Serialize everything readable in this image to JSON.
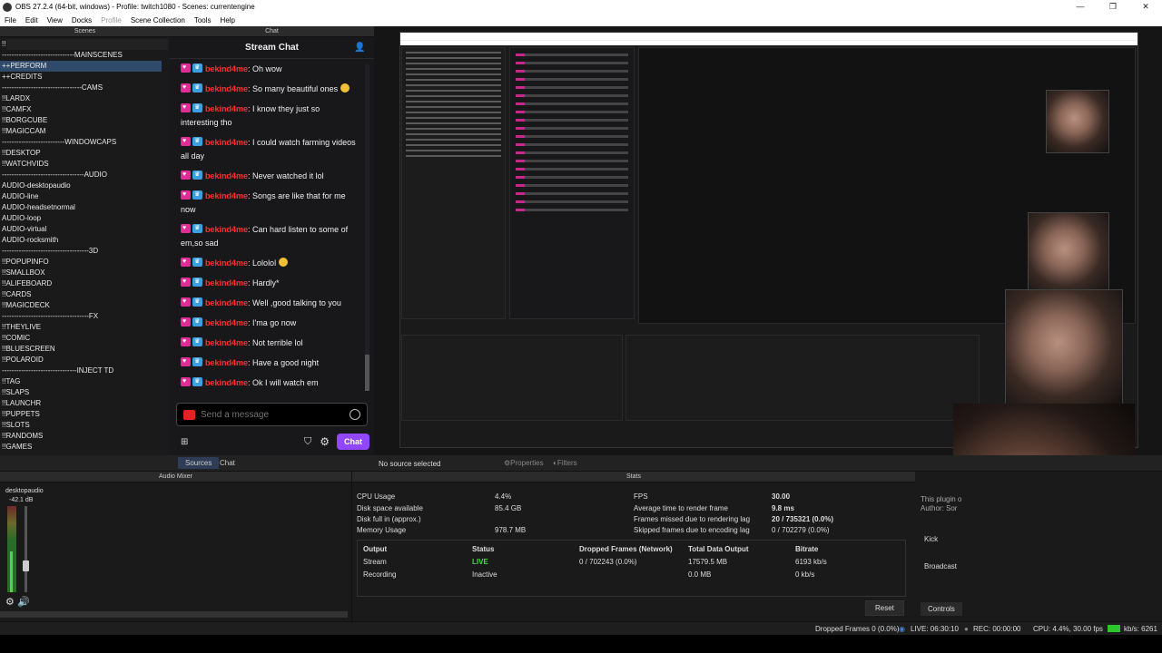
{
  "window": {
    "title": "OBS 27.2.4 (64-bit, windows) - Profile: twitch1080 - Scenes: currentengine"
  },
  "menu": [
    "File",
    "Edit",
    "View",
    "Docks",
    "Profile",
    "Scene Collection",
    "Tools",
    "Help"
  ],
  "scenes": {
    "header": "Scenes",
    "items": [
      "!!!SCENESWITCH",
      "------------------------------MAINSCENES",
      "++PERFORM",
      "++CREDITS",
      "---------------------------------CAMS",
      "!!LARDX",
      "!!CAMFX",
      "!!BORGCUBE",
      "!!MAGICCAM",
      "--------------------------WINDOWCAPS",
      "!!DESKTOP",
      "!!WATCHVIDS",
      "----------------------------------AUDIO",
      "AUDIO-desktopaudio",
      "AUDIO-line",
      "AUDIO-headsetnormal",
      "AUDIO-loop",
      "AUDIO-virtual",
      "AUDIO-rocksmith",
      "------------------------------------3D",
      "!!POPUPINFO",
      "!!SMALLBOX",
      "!!ALIFEBOARD",
      "!!CARDS",
      "!!MAGICDECK",
      "------------------------------------FX",
      "!!THEYLIVE",
      "!!COMIC",
      "!!BLUESCREEN",
      "!!POLAROID",
      "-------------------------------INJECT TD",
      "!!TAG",
      "!!SLAPS",
      "!!LAUNCHR",
      "!!PUPPETS",
      "!!SLOTS",
      "!!RANDOMS",
      "!!GAMES"
    ],
    "selected": "++PERFORM",
    "controls": [
      "+",
      "—",
      "⌃",
      "⌄"
    ]
  },
  "chat": {
    "header": "Chat",
    "title": "Stream Chat",
    "username": "bekind4me",
    "messages": [
      "Oh wow",
      "So many beautiful ones",
      "I know they just so interesting tho",
      "I could watch farming videos all day",
      "Never watched it lol",
      "Songs are like that for me now",
      "Can hard listen to some of em,so sad",
      "Lololol",
      "Hardly*",
      "Well ,good talking to you",
      "I'ma go now",
      "Not terrible lol",
      "Have a good night",
      "Ok I will watch em"
    ],
    "input_placeholder": "Send a message",
    "send_label": "Chat"
  },
  "tabs": {
    "sources": "Sources",
    "chat": "Chat"
  },
  "source_bar": {
    "no_source": "No source selected",
    "properties": "Properties",
    "filters": "Filters"
  },
  "audio": {
    "header": "Audio Mixer",
    "source": "desktopaudio",
    "db": "-42.1 dB",
    "level": 0.35
  },
  "stats": {
    "header": "Stats",
    "cpu_label": "CPU Usage",
    "cpu": "4.4%",
    "disk_label": "Disk space available",
    "disk": "85.4 GB",
    "diskfull_label": "Disk full in (approx.)",
    "diskfull": "",
    "mem_label": "Memory Usage",
    "mem": "978.7 MB",
    "fps_label": "FPS",
    "fps": "30.00",
    "render_label": "Average time to render frame",
    "render": "9.8 ms",
    "missed_label": "Frames missed due to rendering lag",
    "missed": "20 / 735321 (0.0%)",
    "skipped_label": "Skipped frames due to encoding lag",
    "skipped": "0 / 702279 (0.0%)",
    "columns": [
      "Output",
      "Status",
      "Dropped Frames (Network)",
      "Total Data Output",
      "Bitrate"
    ],
    "stream": [
      "Stream",
      "LIVE",
      "0 / 702243 (0.0%)",
      "17579.5 MB",
      "6193 kb/s"
    ],
    "recording": [
      "Recording",
      "Inactive",
      "",
      "0.0 MB",
      "0 kb/s"
    ],
    "reset": "Reset"
  },
  "controls_dock": {
    "text1": "This plugin o",
    "text2": "Author: Sor",
    "kick": "Kick",
    "broadcast": "Broadcast",
    "tab": "Controls"
  },
  "status": {
    "dropped": "Dropped Frames 0 (0.0%)",
    "live": "LIVE: 06:30:10",
    "rec": "REC: 00:00:00",
    "cpu": "CPU: 4.4%, 30.00 fps",
    "kbs": "kb/s: 6261"
  }
}
